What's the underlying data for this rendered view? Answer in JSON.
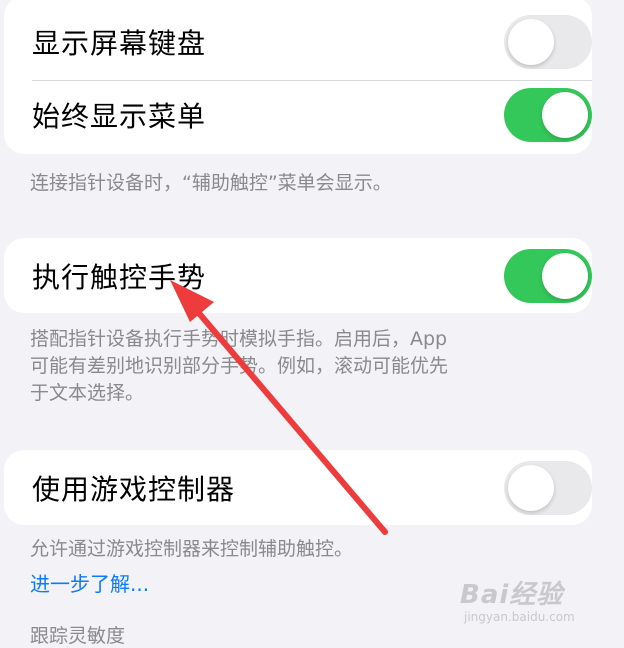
{
  "group1": {
    "row1": {
      "label": "显示屏幕键盘",
      "toggle_on": false
    },
    "row2": {
      "label": "始终显示菜单",
      "toggle_on": true
    }
  },
  "footer1": "连接指针设备时，“辅助触控”菜单会显示。",
  "group2": {
    "row1": {
      "label": "执行触控手势",
      "toggle_on": true
    }
  },
  "footer2_lines": [
    "搭配指针设备执行手势时模拟手指。启用后，App",
    "可能有差别地识别部分手势。例如，滚动可能优先",
    "于文本选择。"
  ],
  "group3": {
    "row1": {
      "label": "使用游戏控制器",
      "toggle_on": false
    }
  },
  "footer3": "允许通过游戏控制器来控制辅助触控。",
  "learn_more_link": "进一步了解...",
  "section_header": "跟踪灵敏度",
  "watermark": {
    "brand": "Bai经验",
    "sub": "jingyan.baidu.com"
  },
  "colors": {
    "toggle_on": "#34c759",
    "toggle_off": "#e9e9eb",
    "link": "#0a7aff",
    "annotation_arrow": "#ee3b3b"
  }
}
